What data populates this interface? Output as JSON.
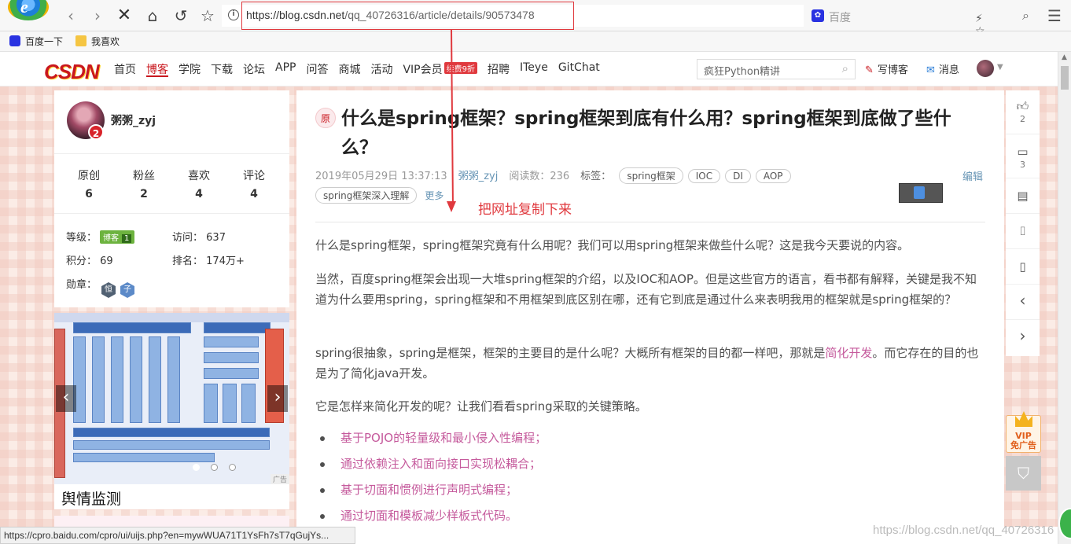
{
  "browser": {
    "url_host": "https://blog.csdn.net",
    "url_path": "/qq_40726316/article/details/90573478",
    "search_placeholder": "百度",
    "bookmarks": [
      "百度一下",
      "我喜欢"
    ]
  },
  "site": {
    "logo": "CSDN",
    "nav": [
      "首页",
      "博客",
      "学院",
      "下载",
      "论坛",
      "APP",
      "问答",
      "商城",
      "活动",
      "VIP会员",
      "招聘",
      "ITeye",
      "GitChat"
    ],
    "vip_badge": "续费9折",
    "search_value": "疯狂Python精讲",
    "write_blog": "写博客",
    "messages": "消息"
  },
  "profile": {
    "username": "粥粥_zyj",
    "avatar_badge": "2",
    "stats": [
      {
        "label": "原创",
        "value": "6"
      },
      {
        "label": "粉丝",
        "value": "2"
      },
      {
        "label": "喜欢",
        "value": "4"
      },
      {
        "label": "评论",
        "value": "4"
      }
    ],
    "level_label": "等级：",
    "level_badge": "博客",
    "level_num": "1",
    "visits_label": "访问：",
    "visits": "637",
    "points_label": "积分：",
    "points": "69",
    "rank_label": "排名：",
    "rank": "174万+",
    "medals_label": "勋章：",
    "medals": [
      "恒",
      "子"
    ]
  },
  "ad": {
    "caption": "舆情监测",
    "tag": "广告"
  },
  "article": {
    "orig_tag": "原",
    "title": "什么是spring框架？spring框架到底有什么用？spring框架到底做了些什么？",
    "date": "2019年05月29日 13:37:13",
    "author": "粥粥_zyj",
    "read_label": "阅读数：",
    "read_count": "236",
    "tags_label": "标签：",
    "tags": [
      "spring框架",
      "IOC",
      "DI",
      "AOP"
    ],
    "category": "spring框架深入理解",
    "more": "更多",
    "edit": "编辑",
    "p1": "什么是spring框架，spring框架究竟有什么用呢？我们可以用spring框架来做些什么呢？这是我今天要说的内容。",
    "p2": "当然，百度spring框架会出现一大堆spring框架的介绍，以及IOC和AOP。但是这些官方的语言，看书都有解释，关键是我不知道为什么要用spring，spring框架和不用框架到底区别在哪，还有它到底是通过什么来表明我用的框架就是spring框架的？",
    "p3_a": "spring很抽象，spring是框架，框架的主要目的是什么呢？大概所有框架的目的都一样吧，那就是",
    "p3_hl": "简化开发",
    "p3_b": "。而它存在的目的也是为了简化java开发。",
    "p4": "它是怎样来简化开发的呢？让我们看看spring采取的关键策略。",
    "list": [
      "基于POJO的轻量级和最小侵入性编程；",
      "通过依赖注入和面向接口实现松耦合；",
      "基于切面和惯例进行声明式编程；",
      "通过切面和模板减少样板式代码。"
    ]
  },
  "annotation": "把网址复制下来",
  "toolbar": {
    "likes": "2",
    "comments": "3"
  },
  "vip_ad": {
    "line1": "VIP",
    "line2": "免广告"
  },
  "statusbar": "https://cpro.baidu.com/cpro/ui/uijs.php?en=mywWUA71T1YsFh7sT7qGujYs...",
  "watermark": "https://blog.csdn.net/qq_40726316",
  "colors": {
    "accent": "#c9171e",
    "link": "#6795b5",
    "highlight": "#c55a9c",
    "annotation": "#e0393e"
  }
}
